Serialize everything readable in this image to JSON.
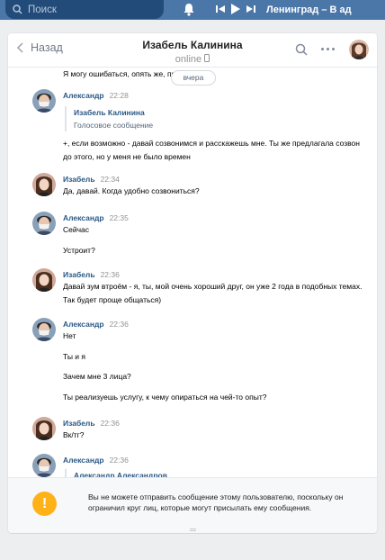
{
  "topbar": {
    "search_placeholder": "Поиск",
    "now_playing": "Ленинград – В ад"
  },
  "header": {
    "back_label": "Назад",
    "peer_name": "Изабель Калинина",
    "peer_status": "online"
  },
  "date_pill": "вчера",
  "messages": [
    {
      "text": "Я могу ошибаться, опять же, прошу:"
    },
    {
      "author": "Александр",
      "time": "22:28",
      "reply_name": "Изабель Калинина",
      "reply_sub": "Голосовое сообщение",
      "text": "+, если возможно - давай созвонимся и расскажешь мне. Ты же предлагала созвон до этого, но у меня не было времен"
    },
    {
      "author": "Изабель",
      "time": "22:34",
      "text": "Да, давай. Когда удобно созвониться?"
    },
    {
      "author": "Александр",
      "time": "22:35",
      "text": "Сейчас",
      "text2": "Устроит?"
    },
    {
      "author": "Изабель",
      "time": "22:36",
      "text": "Давай зум втроём - я, ты, мой очень хороший друг, он уже 2 года в подобных темах. Так будет проще общаться)"
    },
    {
      "author": "Александр",
      "time": "22:36",
      "text": "Нет",
      "text2": "Ты и я",
      "text3": "Зачем мне 3 лица?",
      "text4": "Ты реализуешь услугу, к чему опираться на чей-то опыт?"
    },
    {
      "author": "Изабель",
      "time": "22:36",
      "text": "Вк/тг?"
    },
    {
      "author": "Александр",
      "time": "22:36",
      "reply_name": "Александр Александров"
    }
  ],
  "footer": {
    "notice": "Вы не можете отправить сообщение этому пользователю, поскольку он ограничил круг лиц, которые могут присылать ему сообщения."
  },
  "colors": {
    "topbar": "#4a76a8",
    "link": "#2a5885",
    "warning": "#ffb217"
  }
}
